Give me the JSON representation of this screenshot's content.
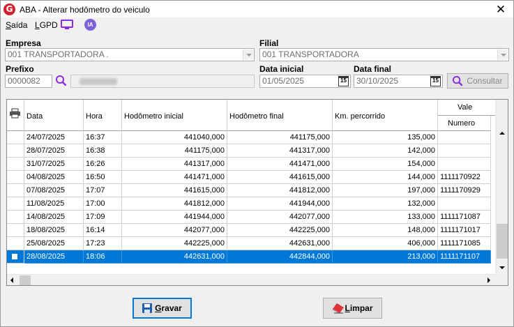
{
  "window": {
    "title": "ABA - Alterar hodômetro do veiculo",
    "logo_letter": "G",
    "close_glyph": "✕"
  },
  "menu": {
    "exit_accel": "S",
    "exit_rest": "aída",
    "lgpd_accel": "L",
    "lgpd_rest": "GPD",
    "ia_label": "IA"
  },
  "filters": {
    "empresa_label": "Empresa",
    "empresa_value": "001 TRANSPORTADORA .",
    "filial_label": "Filial",
    "filial_value": "001 TRANSPORTADORA",
    "prefixo_label": "Prefixo",
    "prefixo_value": "0000082",
    "data_inicial_label": "Data inicial",
    "data_inicial_value": "01/05/2025",
    "data_final_label": "Data final",
    "data_final_value": "30/10/2025",
    "calendar_glyph": "15",
    "consultar_label": "Consultar"
  },
  "grid": {
    "columns": [
      "Data",
      "Hora",
      "Hodômetro inicial",
      "Hodômetro final",
      "Km. percorrido"
    ],
    "group_header": "Vale",
    "sub_column": "Numero",
    "rows": [
      {
        "data": "24/07/2025",
        "hora": "16:37",
        "ini": "441040,000",
        "fim": "441175,000",
        "km": "135,000",
        "num": ""
      },
      {
        "data": "28/07/2025",
        "hora": "16:38",
        "ini": "441175,000",
        "fim": "441317,000",
        "km": "142,000",
        "num": ""
      },
      {
        "data": "31/07/2025",
        "hora": "16:26",
        "ini": "441317,000",
        "fim": "441471,000",
        "km": "154,000",
        "num": ""
      },
      {
        "data": "04/08/2025",
        "hora": "16:50",
        "ini": "441471,000",
        "fim": "441615,000",
        "km": "144,000",
        "num": "1111170922"
      },
      {
        "data": "07/08/2025",
        "hora": "17:07",
        "ini": "441615,000",
        "fim": "441812,000",
        "km": "197,000",
        "num": "1111170929"
      },
      {
        "data": "11/08/2025",
        "hora": "17:00",
        "ini": "441812,000",
        "fim": "441944,000",
        "km": "132,000",
        "num": ""
      },
      {
        "data": "14/08/2025",
        "hora": "17:09",
        "ini": "441944,000",
        "fim": "442077,000",
        "km": "133,000",
        "num": "1111171087"
      },
      {
        "data": "18/08/2025",
        "hora": "16:14",
        "ini": "442077,000",
        "fim": "442225,000",
        "km": "148,000",
        "num": "1111171017"
      },
      {
        "data": "25/08/2025",
        "hora": "17:23",
        "ini": "442225,000",
        "fim": "442631,000",
        "km": "406,000",
        "num": "1111171085"
      },
      {
        "data": "28/08/2025",
        "hora": "18:06",
        "ini": "442631,000",
        "fim": "442844,000",
        "km": "213,000",
        "num": "1111171107",
        "selected": true
      }
    ]
  },
  "footer": {
    "gravar_accel": "G",
    "gravar_rest": "ravar",
    "limpar_accel": "L",
    "limpar_rest": "impar"
  },
  "colors": {
    "selection": "#0078d7",
    "logo": "#d1202f",
    "ia": "#7b61d9",
    "monitor": "#8a2be2"
  }
}
